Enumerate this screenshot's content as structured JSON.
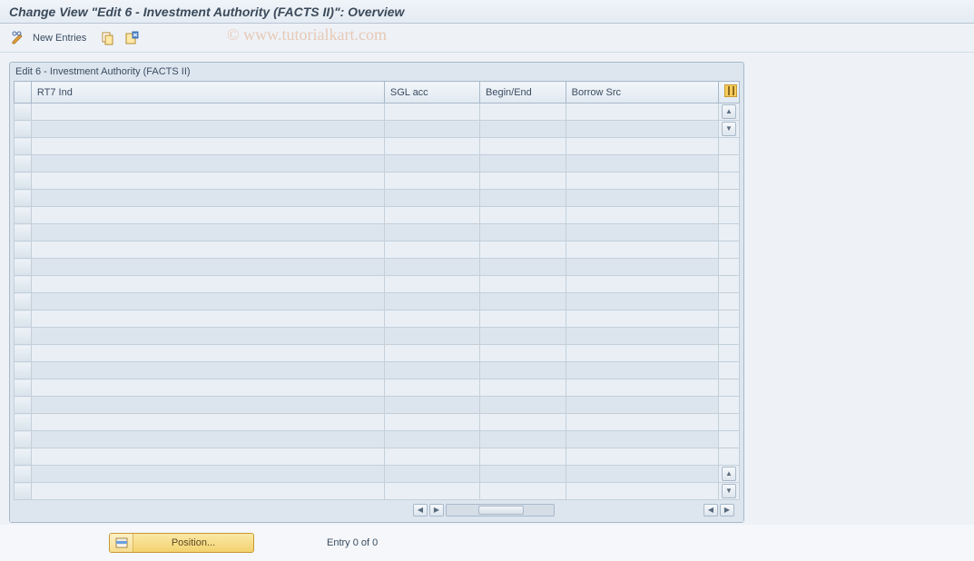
{
  "title": "Change View \"Edit 6 - Investment Authority  (FACTS II)\": Overview",
  "toolbar": {
    "new_entries_label": "New Entries"
  },
  "watermark": "© www.tutorialkart.com",
  "panel": {
    "title": "Edit 6 - Investment Authority  (FACTS II)",
    "columns": {
      "rt7": "RT7 Ind",
      "sgl": "SGL acc",
      "begin_end": "Begin/End",
      "borrow": "Borrow Src"
    }
  },
  "footer": {
    "position_label": "Position...",
    "entry_text": "Entry 0 of 0"
  }
}
